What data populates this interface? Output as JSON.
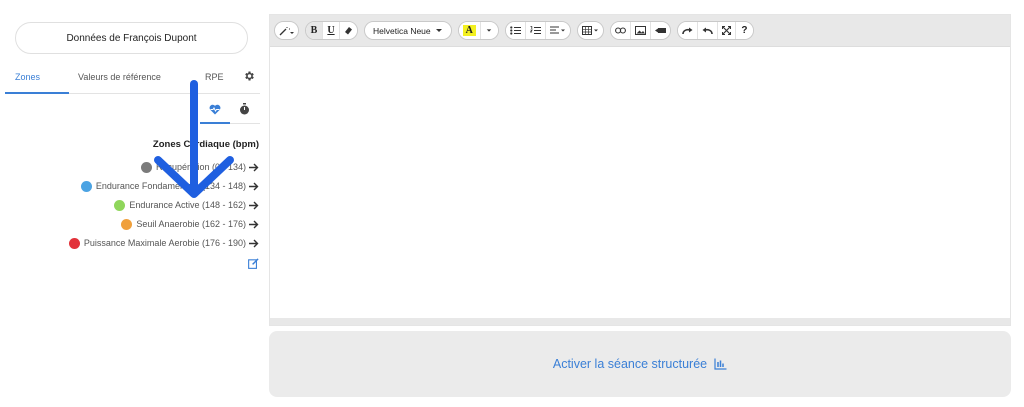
{
  "user_button": "Données de François Dupont",
  "tabs": [
    {
      "label": "Zones",
      "active": true
    },
    {
      "label": "Valeurs de référence",
      "active": false
    },
    {
      "label": "RPE",
      "active": false
    }
  ],
  "zones_title": "Zones Cardiaque (bpm)",
  "zones": [
    {
      "label": "Récupération (0 - 134)",
      "color": "#7b7b7b"
    },
    {
      "label": "Endurance Fondamentale (134 - 148)",
      "color": "#4ba3e3"
    },
    {
      "label": "Endurance Active (148 - 162)",
      "color": "#8fd65b"
    },
    {
      "label": "Seuil Anaerobie (162 - 176)",
      "color": "#f0a03c"
    },
    {
      "label": "Puissance Maximale Aerobie (176 - 190)",
      "color": "#e2323a"
    }
  ],
  "toolbar": {
    "font_name": "Helvetica Neue",
    "bold": "B",
    "underline": "U",
    "help": "?"
  },
  "activate_label": "Activer la séance structurée",
  "colors": {
    "accent": "#3a7fd6",
    "annotation_arrow": "#1f5fe0"
  }
}
